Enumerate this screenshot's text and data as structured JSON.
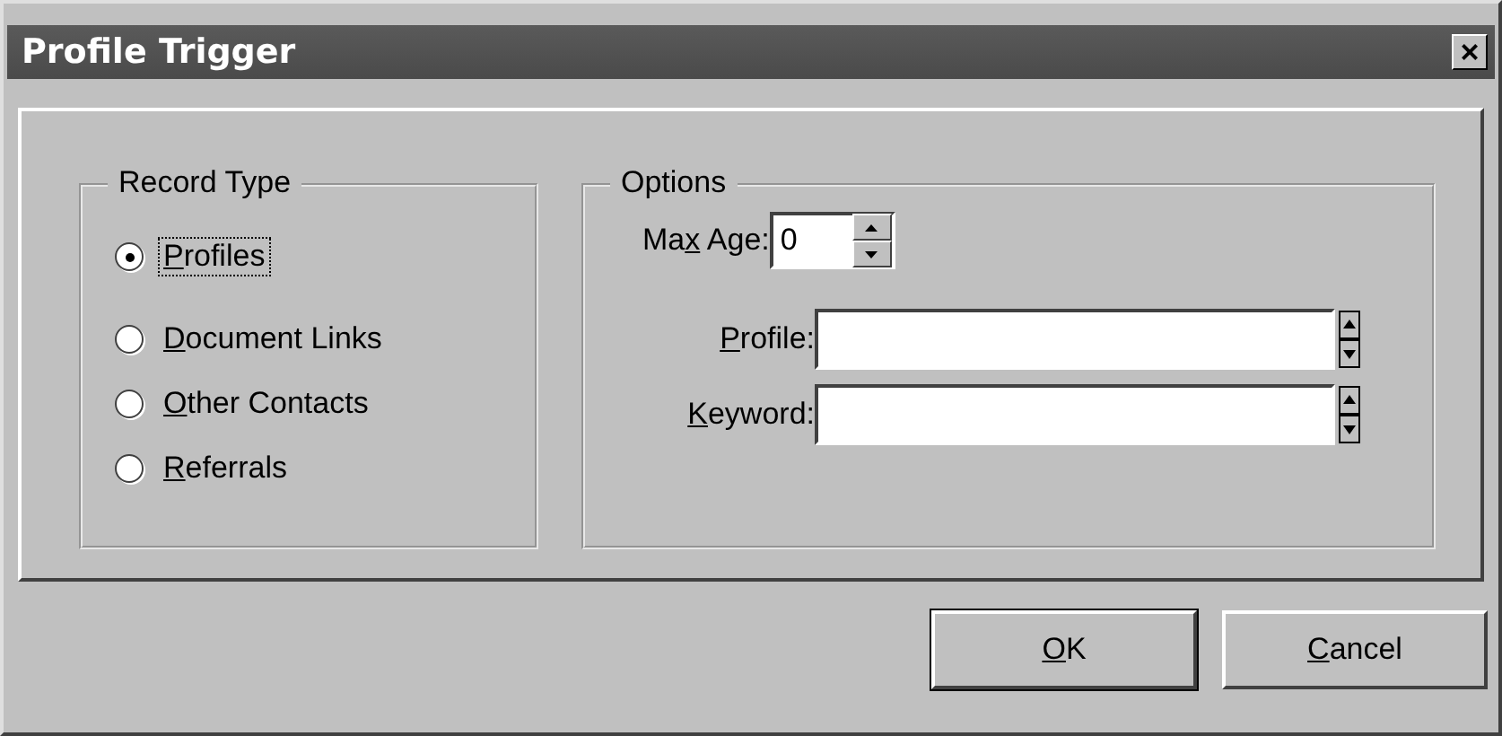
{
  "window": {
    "title": "Profile Trigger",
    "close_label": "×"
  },
  "record_type": {
    "legend": "Record Type",
    "options": [
      {
        "hotkey": "P",
        "label_rest": "rofiles",
        "selected": true,
        "focused": true
      },
      {
        "hotkey": "D",
        "label_rest": "ocument Links",
        "selected": false,
        "focused": false
      },
      {
        "hotkey": "O",
        "label_rest": "ther Contacts",
        "selected": false,
        "focused": false
      },
      {
        "hotkey": "R",
        "label_rest": "eferrals",
        "selected": false,
        "focused": false
      }
    ]
  },
  "options": {
    "legend": "Options",
    "max_age": {
      "label_start": "Ma",
      "hotkey": "x",
      "label_rest": " Age:",
      "value": "0"
    },
    "fields": [
      {
        "hotkey": "P",
        "label_rest": "rofile:"
      },
      {
        "hotkey": "K",
        "label_rest": "eyword:"
      }
    ]
  },
  "buttons": [
    {
      "hotkey": "O",
      "label_rest": "K",
      "default": true
    },
    {
      "hotkey": "C",
      "label_rest": "ancel",
      "default": false
    }
  ]
}
